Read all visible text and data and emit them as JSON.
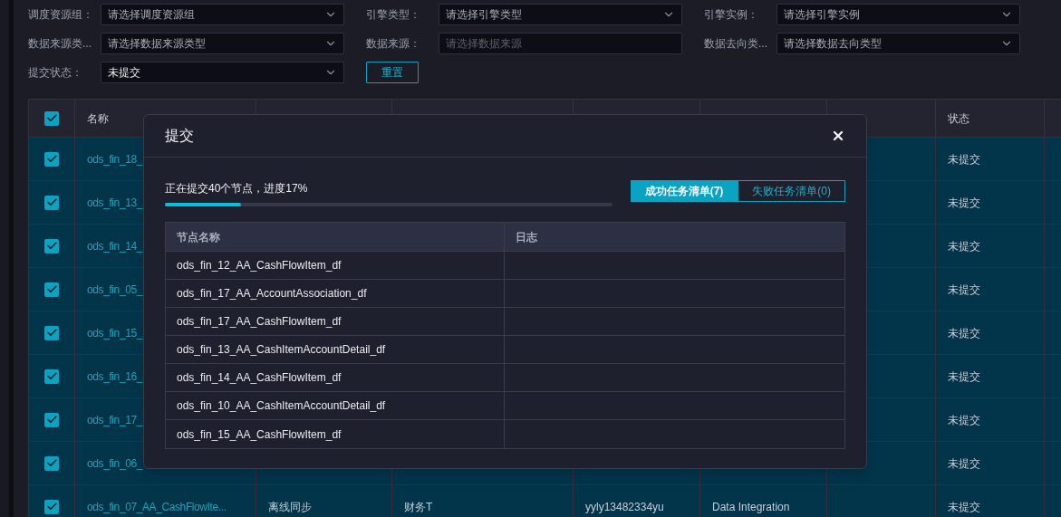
{
  "filter_rows": [
    [
      {
        "label": "调度资源组：",
        "placeholder": "请选择调度资源组",
        "disabled": false
      },
      {
        "label": "引擎类型：",
        "placeholder": "请选择引擎类型",
        "disabled": false
      },
      {
        "label": "引擎实例：",
        "placeholder": "请选择引擎实例",
        "disabled": false
      }
    ],
    [
      {
        "label": "数据来源类...",
        "placeholder": "请选择数据来源类型",
        "disabled": false
      },
      {
        "label": "数据来源：",
        "placeholder": "请选择数据来源",
        "disabled": true
      },
      {
        "label": "数据去向类...",
        "placeholder": "请选择数据去向类型",
        "disabled": false
      }
    ],
    [
      {
        "label": "提交状态：",
        "value": "未提交",
        "disabled": false
      }
    ]
  ],
  "reset_button": "重置",
  "table": {
    "all_checked": true,
    "columns": [
      "名称",
      "状态"
    ],
    "rows": [
      {
        "checked": true,
        "name": "ods_fin_18_",
        "status": "未提交"
      },
      {
        "checked": true,
        "name": "ods_fin_13_",
        "status": "未提交"
      },
      {
        "checked": true,
        "name": "ods_fin_14_",
        "status": "未提交"
      },
      {
        "checked": true,
        "name": "ods_fin_05_",
        "status": "未提交"
      },
      {
        "checked": true,
        "name": "ods_fin_15_",
        "status": "未提交"
      },
      {
        "checked": true,
        "name": "ods_fin_16_",
        "status": "未提交"
      },
      {
        "checked": true,
        "name": "ods_fin_17_",
        "status": "未提交"
      },
      {
        "checked": true,
        "name": "ods_fin_06_",
        "status": "未提交"
      },
      {
        "checked": true,
        "name": "ods_fin_07_AA_CashFlowIte...",
        "type": "离线同步",
        "business_flow": "财务T",
        "owner": "yyly13482334yu",
        "engine_type": "Data Integration",
        "status": "未提交"
      }
    ]
  },
  "dialog": {
    "title": "提交",
    "progress": {
      "text": "正在提交40个节点，进度17%",
      "level": 0.17
    },
    "tabs": [
      {
        "label": "成功任务清单(7)",
        "selected": true
      },
      {
        "label": "失败任务清单(0)",
        "selected": false
      }
    ],
    "node_table": {
      "columns": [
        "节点名称",
        "日志"
      ],
      "rows": [
        {
          "node": "ods_fin_12_AA_CashFlowItem_df"
        },
        {
          "node": "ods_fin_17_AA_AccountAssociation_df"
        },
        {
          "node": "ods_fin_17_AA_CashFlowItem_df"
        },
        {
          "node": "ods_fin_13_AA_CashItemAccountDetail_df"
        },
        {
          "node": "ods_fin_14_AA_CashFlowItem_df"
        },
        {
          "node": "ods_fin_10_AA_CashItemAccountDetail_df"
        },
        {
          "node": "ods_fin_15_AA_CashFlowItem_df"
        }
      ]
    }
  }
}
